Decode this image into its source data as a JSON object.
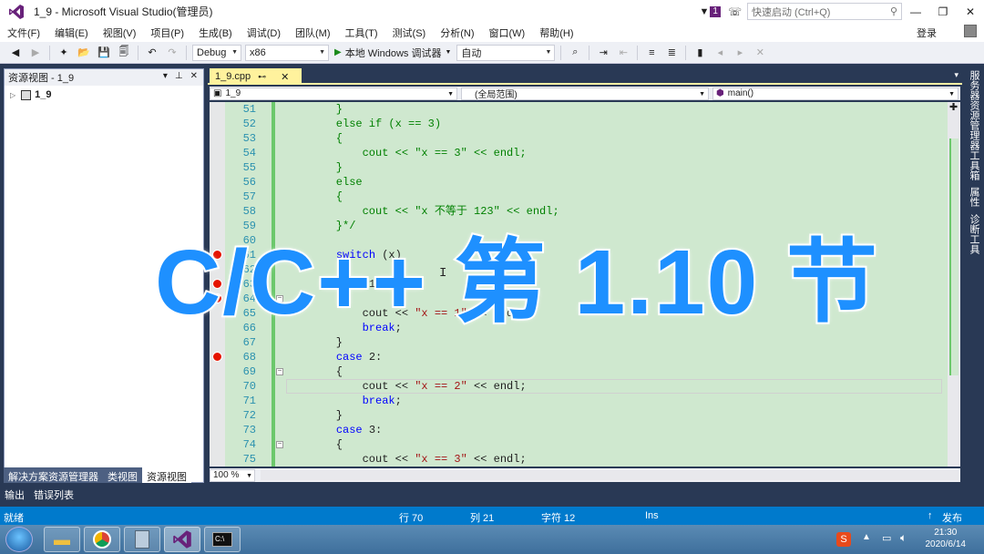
{
  "app": {
    "title": "1_9 - Microsoft Visual Studio(管理员)",
    "notification_count": "1",
    "quick_launch_placeholder": "快速启动 (Ctrl+Q)",
    "login_label": "登录"
  },
  "menu": [
    "文件(F)",
    "编辑(E)",
    "视图(V)",
    "项目(P)",
    "生成(B)",
    "调试(D)",
    "团队(M)",
    "工具(T)",
    "测试(S)",
    "分析(N)",
    "窗口(W)",
    "帮助(H)"
  ],
  "toolbar": {
    "config": "Debug",
    "platform": "x86",
    "run_label": "本地 Windows 调试器",
    "run_mode": "自动"
  },
  "left_panel": {
    "title": "资源视图 - 1_9",
    "root_item": "1_9",
    "bottom_tabs": [
      "解决方案资源管理器",
      "类视图",
      "资源视图"
    ]
  },
  "editor": {
    "tab_name": "1_9.cpp",
    "nav_project": "1_9",
    "nav_scope": "(全局范围)",
    "nav_member": "main()",
    "zoom": "100 %",
    "lines": [
      {
        "n": "51",
        "text": "    }"
      },
      {
        "n": "52",
        "text": "    else if (x == 3)"
      },
      {
        "n": "53",
        "text": "    {"
      },
      {
        "n": "54",
        "text": "        cout << \"x == 3\" << endl;"
      },
      {
        "n": "55",
        "text": "    }"
      },
      {
        "n": "56",
        "text": "    else"
      },
      {
        "n": "57",
        "text": "    {"
      },
      {
        "n": "58",
        "text": "        cout << \"x 不等于 123\" << endl;"
      },
      {
        "n": "59",
        "text": "    }*/"
      },
      {
        "n": "60",
        "text": ""
      },
      {
        "n": "61",
        "text": "    switch (x)"
      },
      {
        "n": "62",
        "text": "    {"
      },
      {
        "n": "63",
        "text": "    case 1:"
      },
      {
        "n": "64",
        "text": "    {"
      },
      {
        "n": "65",
        "text": "        cout << \"x == 1\" << endl;"
      },
      {
        "n": "66",
        "text": "        break;"
      },
      {
        "n": "67",
        "text": "    }"
      },
      {
        "n": "68",
        "text": "    case 2:"
      },
      {
        "n": "69",
        "text": "    {"
      },
      {
        "n": "70",
        "text": "        cout << \"x == 2\" << endl;"
      },
      {
        "n": "71",
        "text": "        break;"
      },
      {
        "n": "72",
        "text": "    }"
      },
      {
        "n": "73",
        "text": "    case 3:"
      },
      {
        "n": "74",
        "text": "    {"
      },
      {
        "n": "75",
        "text": "        cout << \"x == 3\" << endl;"
      }
    ]
  },
  "right_tabs": [
    "服务器资源管理器",
    "工具箱",
    "属性",
    "诊断工具"
  ],
  "output_tabs": [
    "输出",
    "错误列表"
  ],
  "status": {
    "ready": "就绪",
    "row": "行 70",
    "col": "列 21",
    "char": "字符 12",
    "ins": "Ins",
    "publish": "发布"
  },
  "overlay_text": "C/C++ 第 1.10 节",
  "clock": {
    "time": "21:30",
    "date": "2020/6/14"
  },
  "colors": {
    "accent": "#007acc",
    "vs_purple": "#68217a",
    "code_bg": "#cfe8cf",
    "overlay": "#1e90ff"
  }
}
